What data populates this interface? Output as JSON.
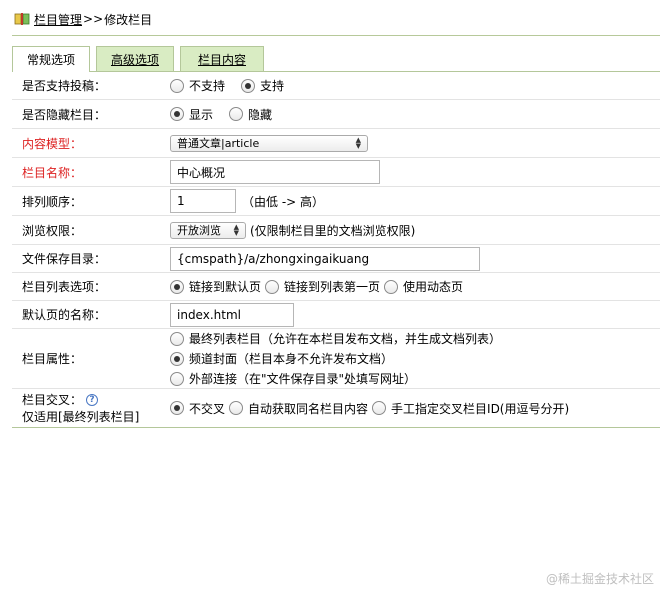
{
  "breadcrumb": {
    "section": "栏目管理",
    "separator": ">>",
    "current": "修改栏目"
  },
  "tabs": [
    {
      "label": "常规选项",
      "active": true
    },
    {
      "label": "高级选项",
      "active": false
    },
    {
      "label": "栏目内容",
      "active": false
    }
  ],
  "form": {
    "submission": {
      "label": "是否支持投稿：",
      "options": [
        "不支持",
        "支持"
      ],
      "selected": "支持"
    },
    "hidden": {
      "label": "是否隐藏栏目：",
      "options": [
        "显示",
        "隐藏"
      ],
      "selected": "显示"
    },
    "content_model": {
      "label": "内容模型：",
      "value": "普通文章|article"
    },
    "column_name": {
      "label": "栏目名称：",
      "value": "中心概况"
    },
    "sort_order": {
      "label": "排列顺序：",
      "value": "1",
      "hint": "（由低 -> 高）"
    },
    "browse_permission": {
      "label": "浏览权限：",
      "value": "开放浏览",
      "hint": "(仅限制栏目里的文档浏览权限)"
    },
    "save_dir": {
      "label": "文件保存目录：",
      "value": "{cmspath}/a/zhongxingaikuang"
    },
    "list_option": {
      "label": "栏目列表选项：",
      "options": [
        "链接到默认页",
        "链接到列表第一页",
        "使用动态页"
      ],
      "selected": "链接到默认页"
    },
    "default_page": {
      "label": "默认页的名称：",
      "value": "index.html"
    },
    "attribute": {
      "label": "栏目属性：",
      "options": [
        "最终列表栏目（允许在本栏目发布文档，并生成文档列表）",
        "频道封面（栏目本身不允许发布文档）",
        "外部连接（在\"文件保存目录\"处填写网址）"
      ],
      "selected": "频道封面（栏目本身不允许发布文档）"
    },
    "cross": {
      "label_line1": "栏目交叉：",
      "label_line2": "仅适用[最终列表栏目]",
      "options": [
        "不交叉",
        "自动获取同名栏目内容",
        "手工指定交叉栏目ID(用逗号分开)"
      ],
      "selected": "不交叉"
    }
  },
  "watermark": "@稀土掘金技术社区",
  "colors": {
    "label_required": "#dd2222",
    "tab_inactive": "#d9ecc3",
    "border": "#b4c79a"
  }
}
